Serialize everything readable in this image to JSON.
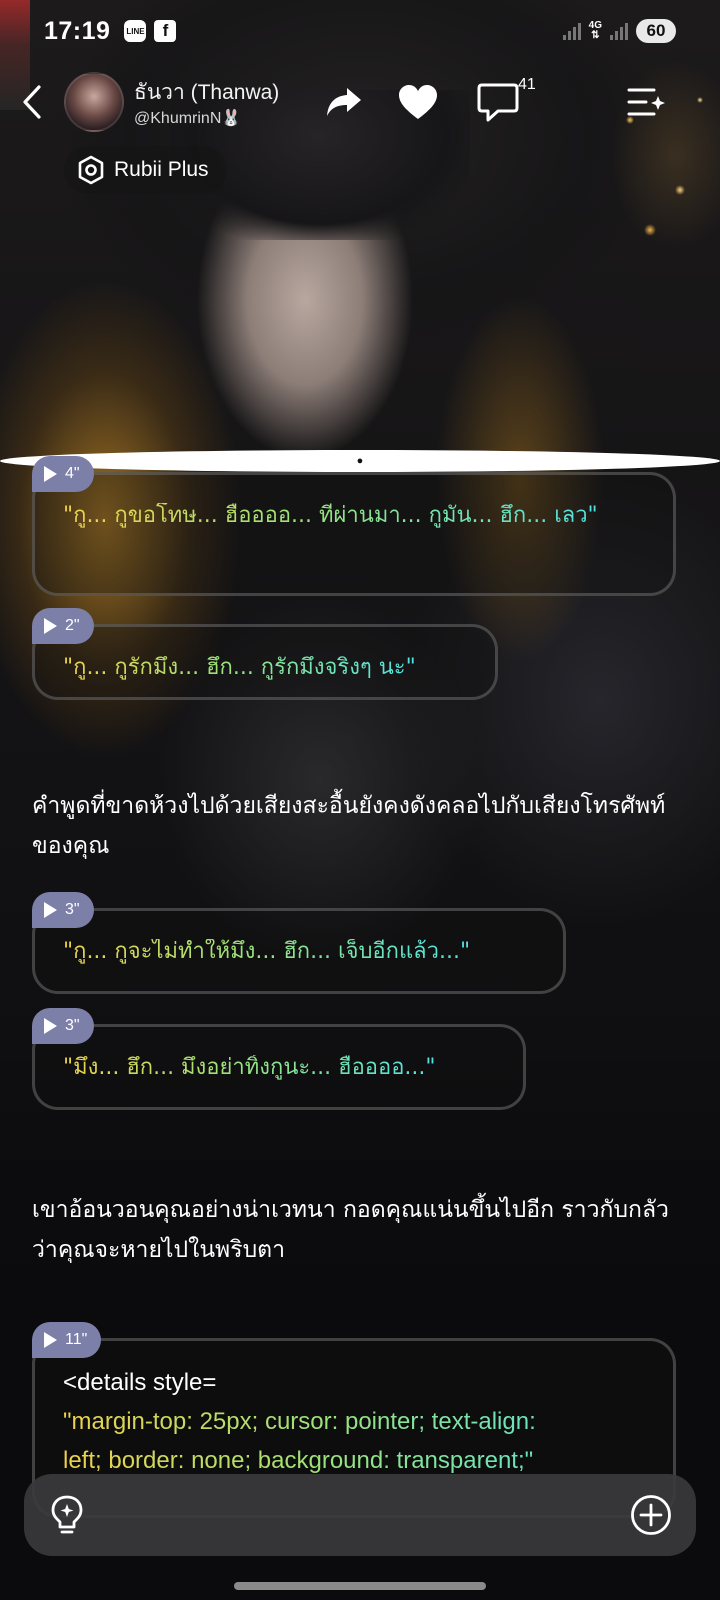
{
  "status_bar": {
    "time": "17:19",
    "apps": [
      "LINE",
      "f",
      "chat"
    ],
    "network": "4G",
    "battery": "60"
  },
  "header": {
    "back_icon": "chevron-left-icon",
    "character_name": "ธันวา (Thanwa)",
    "handle": "@KhumrinN🐰",
    "share_icon": "share-arrow-icon",
    "like_icon": "heart-icon",
    "comment_icon": "comment-bubble-icon",
    "comment_count": "41",
    "menu_icon": "menu-sparkle-icon",
    "plus_badge": "Rubii Plus"
  },
  "messages": [
    {
      "type": "voice",
      "duration": "4\"",
      "text": "\"กู... กูขอโทษ... ฮืออออ... ที่ผ่านมา... กูมัน... ฮึก... เลว\""
    },
    {
      "type": "voice",
      "duration": "2\"",
      "text": "\"กู... กูรักมึง... ฮึก... กูรักมึงจริงๆ นะ\""
    },
    {
      "type": "narration",
      "text": "คำพูดที่ขาดห้วงไปด้วยเสียงสะอื้นยังคงดังคลอไปกับเสียงโทรศัพท์ของคุณ"
    },
    {
      "type": "voice",
      "duration": "3\"",
      "text": "\"กู... กูจะไม่ทำให้มึง... ฮึก... เจ็บอีกแล้ว...\""
    },
    {
      "type": "voice",
      "duration": "3\"",
      "text": "\"มึง... ฮึก... มึงอย่าทิ้งกูนะ... ฮืออออ...\""
    },
    {
      "type": "narration",
      "text": "เขาอ้อนวอนคุณอย่างน่าเวทนา กอดคุณแน่นขึ้นไปอีก ราวกับกลัวว่าคุณจะหายไปในพริบตา"
    },
    {
      "type": "voice",
      "duration": "11\"",
      "lines": [
        "<details style=",
        "\"margin-top: 25px; cursor: pointer; text-align:",
        "left; border: none; background: transparent;\""
      ]
    }
  ],
  "input_bar": {
    "inspire_icon": "lightbulb-sparkle-icon",
    "placeholder": "",
    "add_icon": "plus-circle-icon"
  },
  "colors": {
    "voice_tag": "#7c7fa8",
    "quote_gradient": [
      "#f0d24a",
      "#9be37a",
      "#4fe3e6"
    ],
    "input_bar": "#3a3a3c"
  }
}
